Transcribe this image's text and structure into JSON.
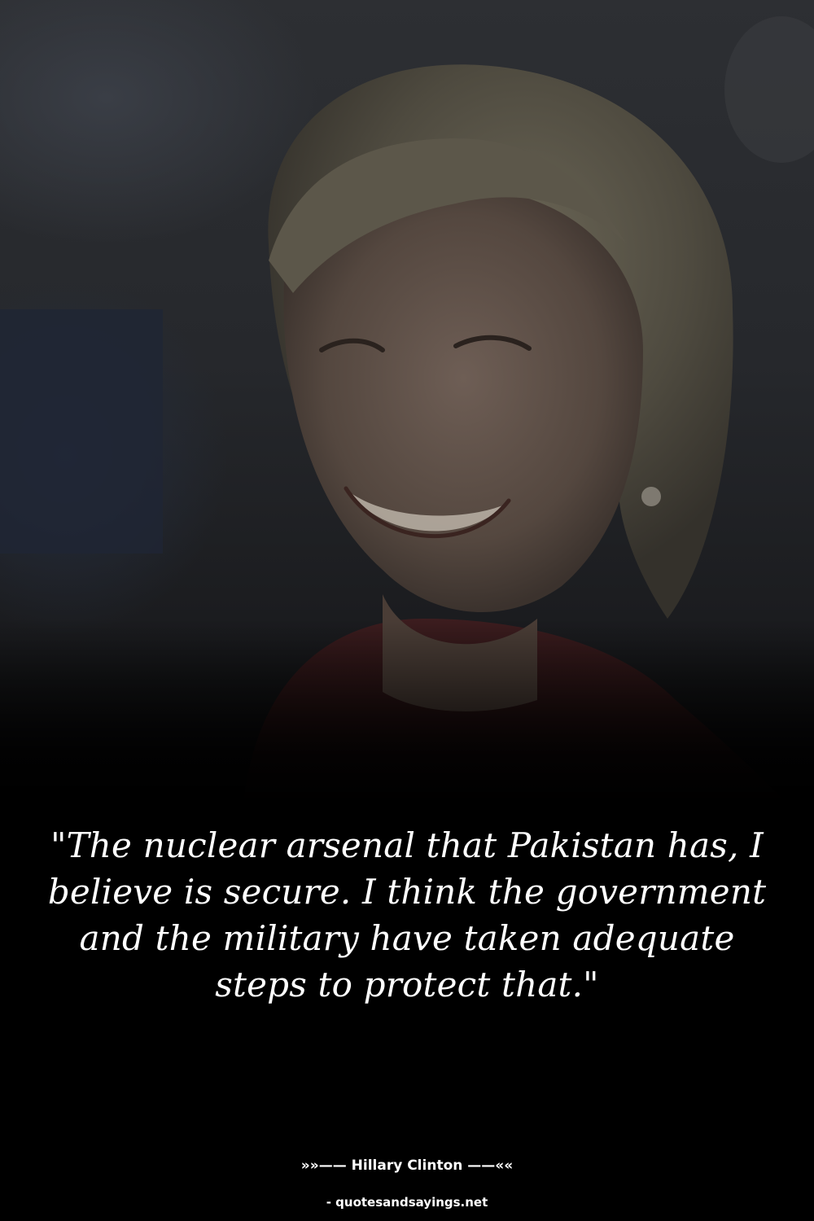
{
  "quote": {
    "text": "\"The nuclear arsenal that Pakistan has, I believe is secure. I think the government and the military have taken adequate steps to protect that.\""
  },
  "author": {
    "name": "Hillary Clinton",
    "prefix_ornament": "»»——",
    "suffix_ornament": "——««"
  },
  "source": {
    "text": "- quotesandsayings.net"
  },
  "colors": {
    "background": "#000000",
    "text": "#ffffff",
    "photo_tint": "#2a2c30"
  }
}
